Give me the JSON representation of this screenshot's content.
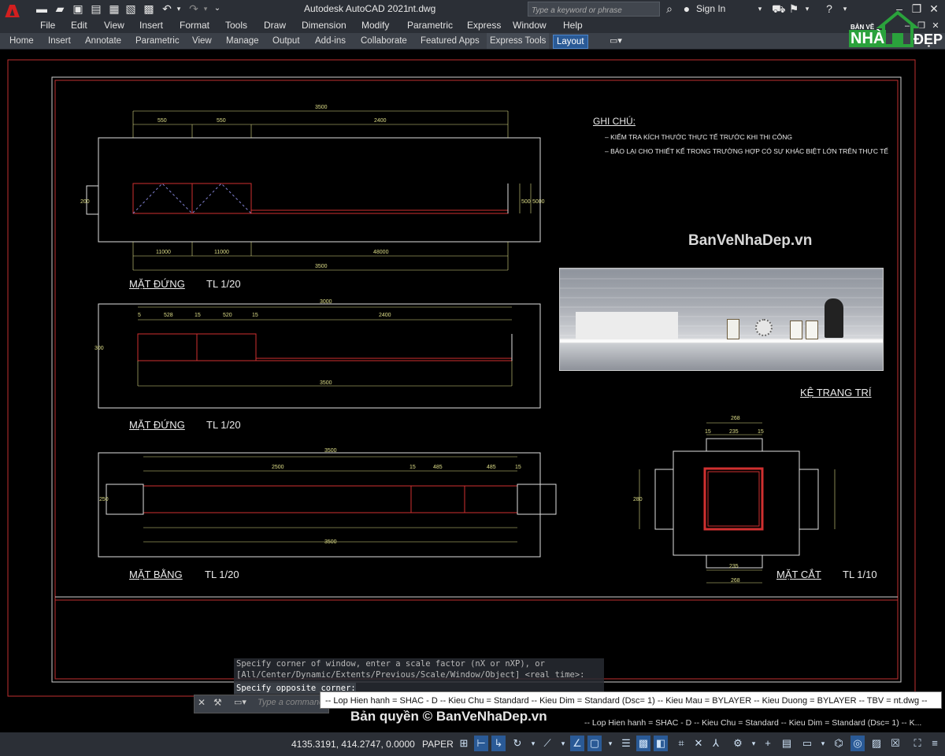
{
  "app": {
    "logo_letter": "A",
    "title": "Autodesk AutoCAD 2021",
    "file": "nt.dwg",
    "search_placeholder": "Type a keyword or phrase",
    "signin": "Sign In"
  },
  "menu": [
    "File",
    "Edit",
    "View",
    "Insert",
    "Format",
    "Tools",
    "Draw",
    "Dimension",
    "Modify",
    "Parametric",
    "Express",
    "Window",
    "Help"
  ],
  "ribbon_tabs": [
    "Home",
    "Insert",
    "Annotate",
    "Parametric",
    "View",
    "Manage",
    "Output",
    "Add-ins",
    "Collaborate",
    "Featured Apps",
    "Express Tools",
    "Layout"
  ],
  "watermark_logo": {
    "top": "BẢN VẼ",
    "mid": "NHÀ",
    "right": "ĐẸP"
  },
  "drawing": {
    "notes_title": "GHI CHÚ:",
    "notes": [
      "– KIỂM TRA KÍCH THƯỚC THỰC TẾ TRƯỚC KHI THI CÔNG",
      "– BÁO LẠI CHO THIẾT KẾ TRONG TRƯỜNG HỢP CÓ SỰ KHÁC BIỆT LỚN TRÊN THỰC TẾ"
    ],
    "brand": "BanVeNhaDep.vn",
    "photo_caption": "KỆ TRANG TRÍ",
    "views": [
      {
        "title": "MẶT ĐỨNG",
        "scale": "TL 1/20"
      },
      {
        "title": "MẶT ĐỨNG",
        "scale": "TL 1/20"
      },
      {
        "title": "MẶT BẰNG",
        "scale": "TL 1/20"
      },
      {
        "title": "MẶT CẮT",
        "scale": "TL 1/10"
      }
    ],
    "dims1": {
      "total_top": "3500",
      "a": "550",
      "b": "550",
      "c": "2400",
      "bottom_a": "11000",
      "bottom_b": "11000",
      "bottom_c": "48000",
      "total_bottom": "3500",
      "left": "200",
      "right_a": "500",
      "right_b": "5000"
    },
    "dims2": {
      "total_top": "3000",
      "s1": "5",
      "a": "528",
      "s2": "15",
      "b": "520",
      "s3": "15",
      "c": "2400",
      "total_bottom": "3500",
      "left": "300"
    },
    "dims3": {
      "total_top": "3500",
      "a": "2500",
      "s1": "15",
      "b": "485",
      "c": "485",
      "s2": "15",
      "total_bottom": "3500",
      "left": "250"
    },
    "dims4": {
      "top": "268",
      "top_a": "15",
      "top_b": "235",
      "top_c": "15",
      "left": "280",
      "bottom_b": "235",
      "bottom": "268"
    }
  },
  "command": {
    "line1": "Specify corner of window, enter a scale factor (nX or nXP), or",
    "line2": "[All/Center/Dynamic/Extents/Previous/Scale/Window/Object] <real time>:",
    "line3": "Specify opposite corner:",
    "input_placeholder": "Type a command"
  },
  "tooltip": "-- Lop Hien hanh = SHAC - D -- Kieu Chu = Standard -- Kieu Dim = Standard (Dsc= 1) -- Kieu Mau = BYLAYER -- Kieu Duong = BYLAYER -- TBV = nt.dwg --",
  "copyright": "Bản quyền © BanVeNhaDep.vn",
  "status_info": "-- Lop Hien hanh = SHAC - D -- Kieu Chu = Standard -- Kieu Dim = Standard (Dsc= 1) -- K...",
  "coords": "4135.3191, 414.2747, 0.0000",
  "space": "PAPER"
}
